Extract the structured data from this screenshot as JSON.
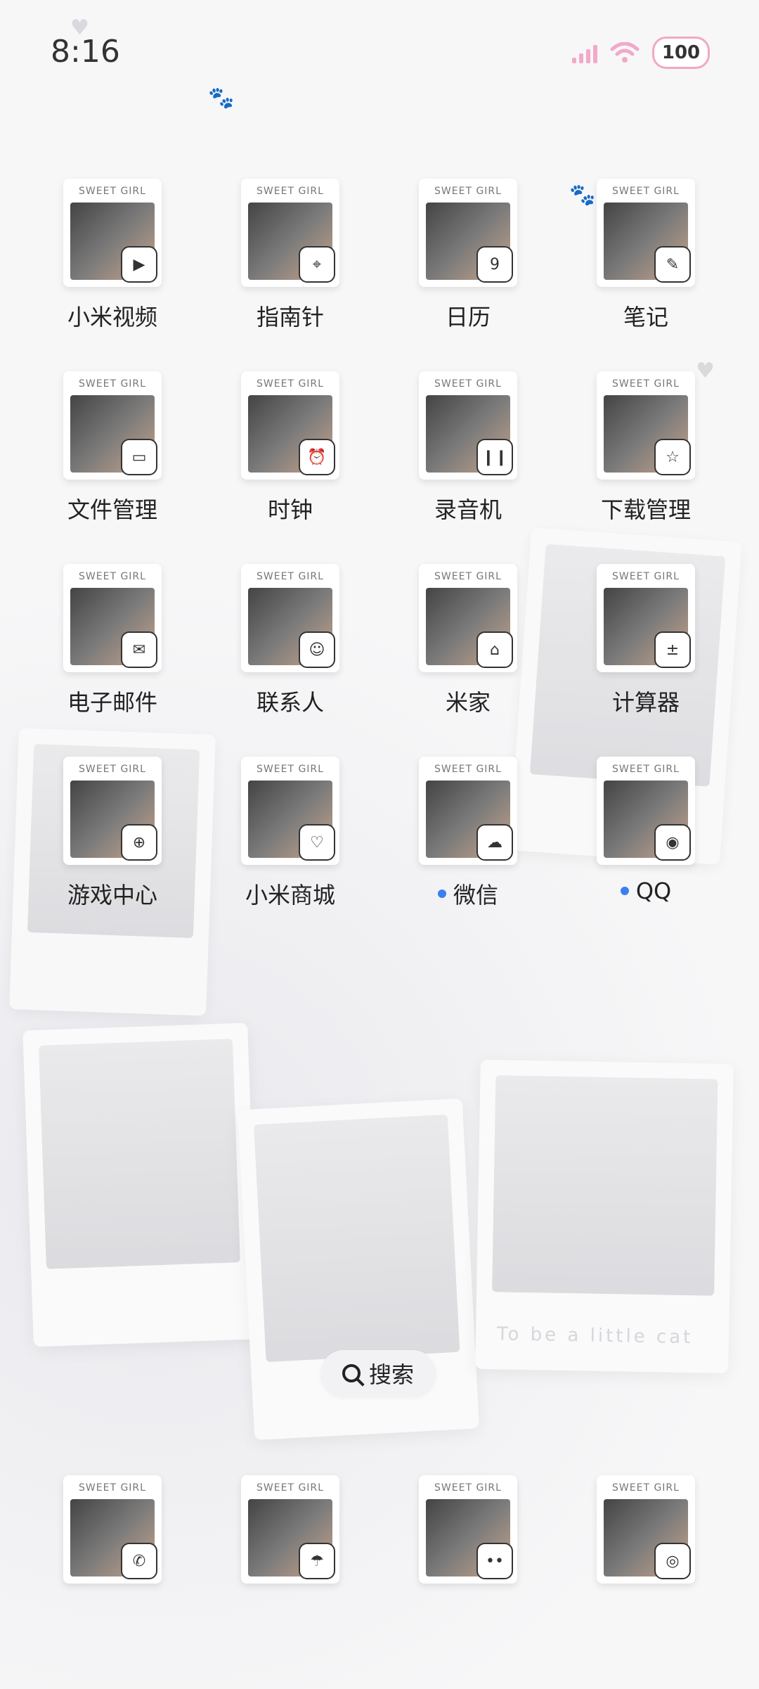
{
  "status_bar": {
    "time": "8:16",
    "battery": "100",
    "colors": {
      "accent": "#f3a7c5"
    }
  },
  "icon_tag_text": "SWEET GIRL",
  "rows": [
    [
      {
        "label": "小米视频",
        "badge_icon": "video-icon"
      },
      {
        "label": "指南针",
        "badge_icon": "compass-icon"
      },
      {
        "label": "日历",
        "badge_icon": "calendar-icon",
        "badge_text": "9"
      },
      {
        "label": "笔记",
        "badge_icon": "note-icon"
      }
    ],
    [
      {
        "label": "文件管理",
        "badge_icon": "folder-icon"
      },
      {
        "label": "时钟",
        "badge_icon": "alarm-clock-icon"
      },
      {
        "label": "录音机",
        "badge_icon": "recorder-icon"
      },
      {
        "label": "下载管理",
        "badge_icon": "download-icon"
      }
    ],
    [
      {
        "label": "电子邮件",
        "badge_icon": "mail-icon"
      },
      {
        "label": "联系人",
        "badge_icon": "contacts-icon"
      },
      {
        "label": "米家",
        "badge_icon": "mijia-icon"
      },
      {
        "label": "计算器",
        "badge_icon": "calculator-icon"
      }
    ],
    [
      {
        "label": "游戏中心",
        "badge_icon": "game-center-icon"
      },
      {
        "label": "小米商城",
        "badge_icon": "shopping-bag-icon"
      },
      {
        "label": "微信",
        "badge_icon": "wechat-icon",
        "new_dot": true
      },
      {
        "label": "QQ",
        "badge_icon": "qq-icon",
        "new_dot": true
      }
    ]
  ],
  "search": {
    "label": "搜索"
  },
  "dock": [
    {
      "badge_icon": "phone-icon"
    },
    {
      "badge_icon": "umbrella-icon"
    },
    {
      "badge_icon": "messages-icon"
    },
    {
      "badge_icon": "camera-icon"
    }
  ],
  "background_captions": [
    "To be a little cat"
  ]
}
